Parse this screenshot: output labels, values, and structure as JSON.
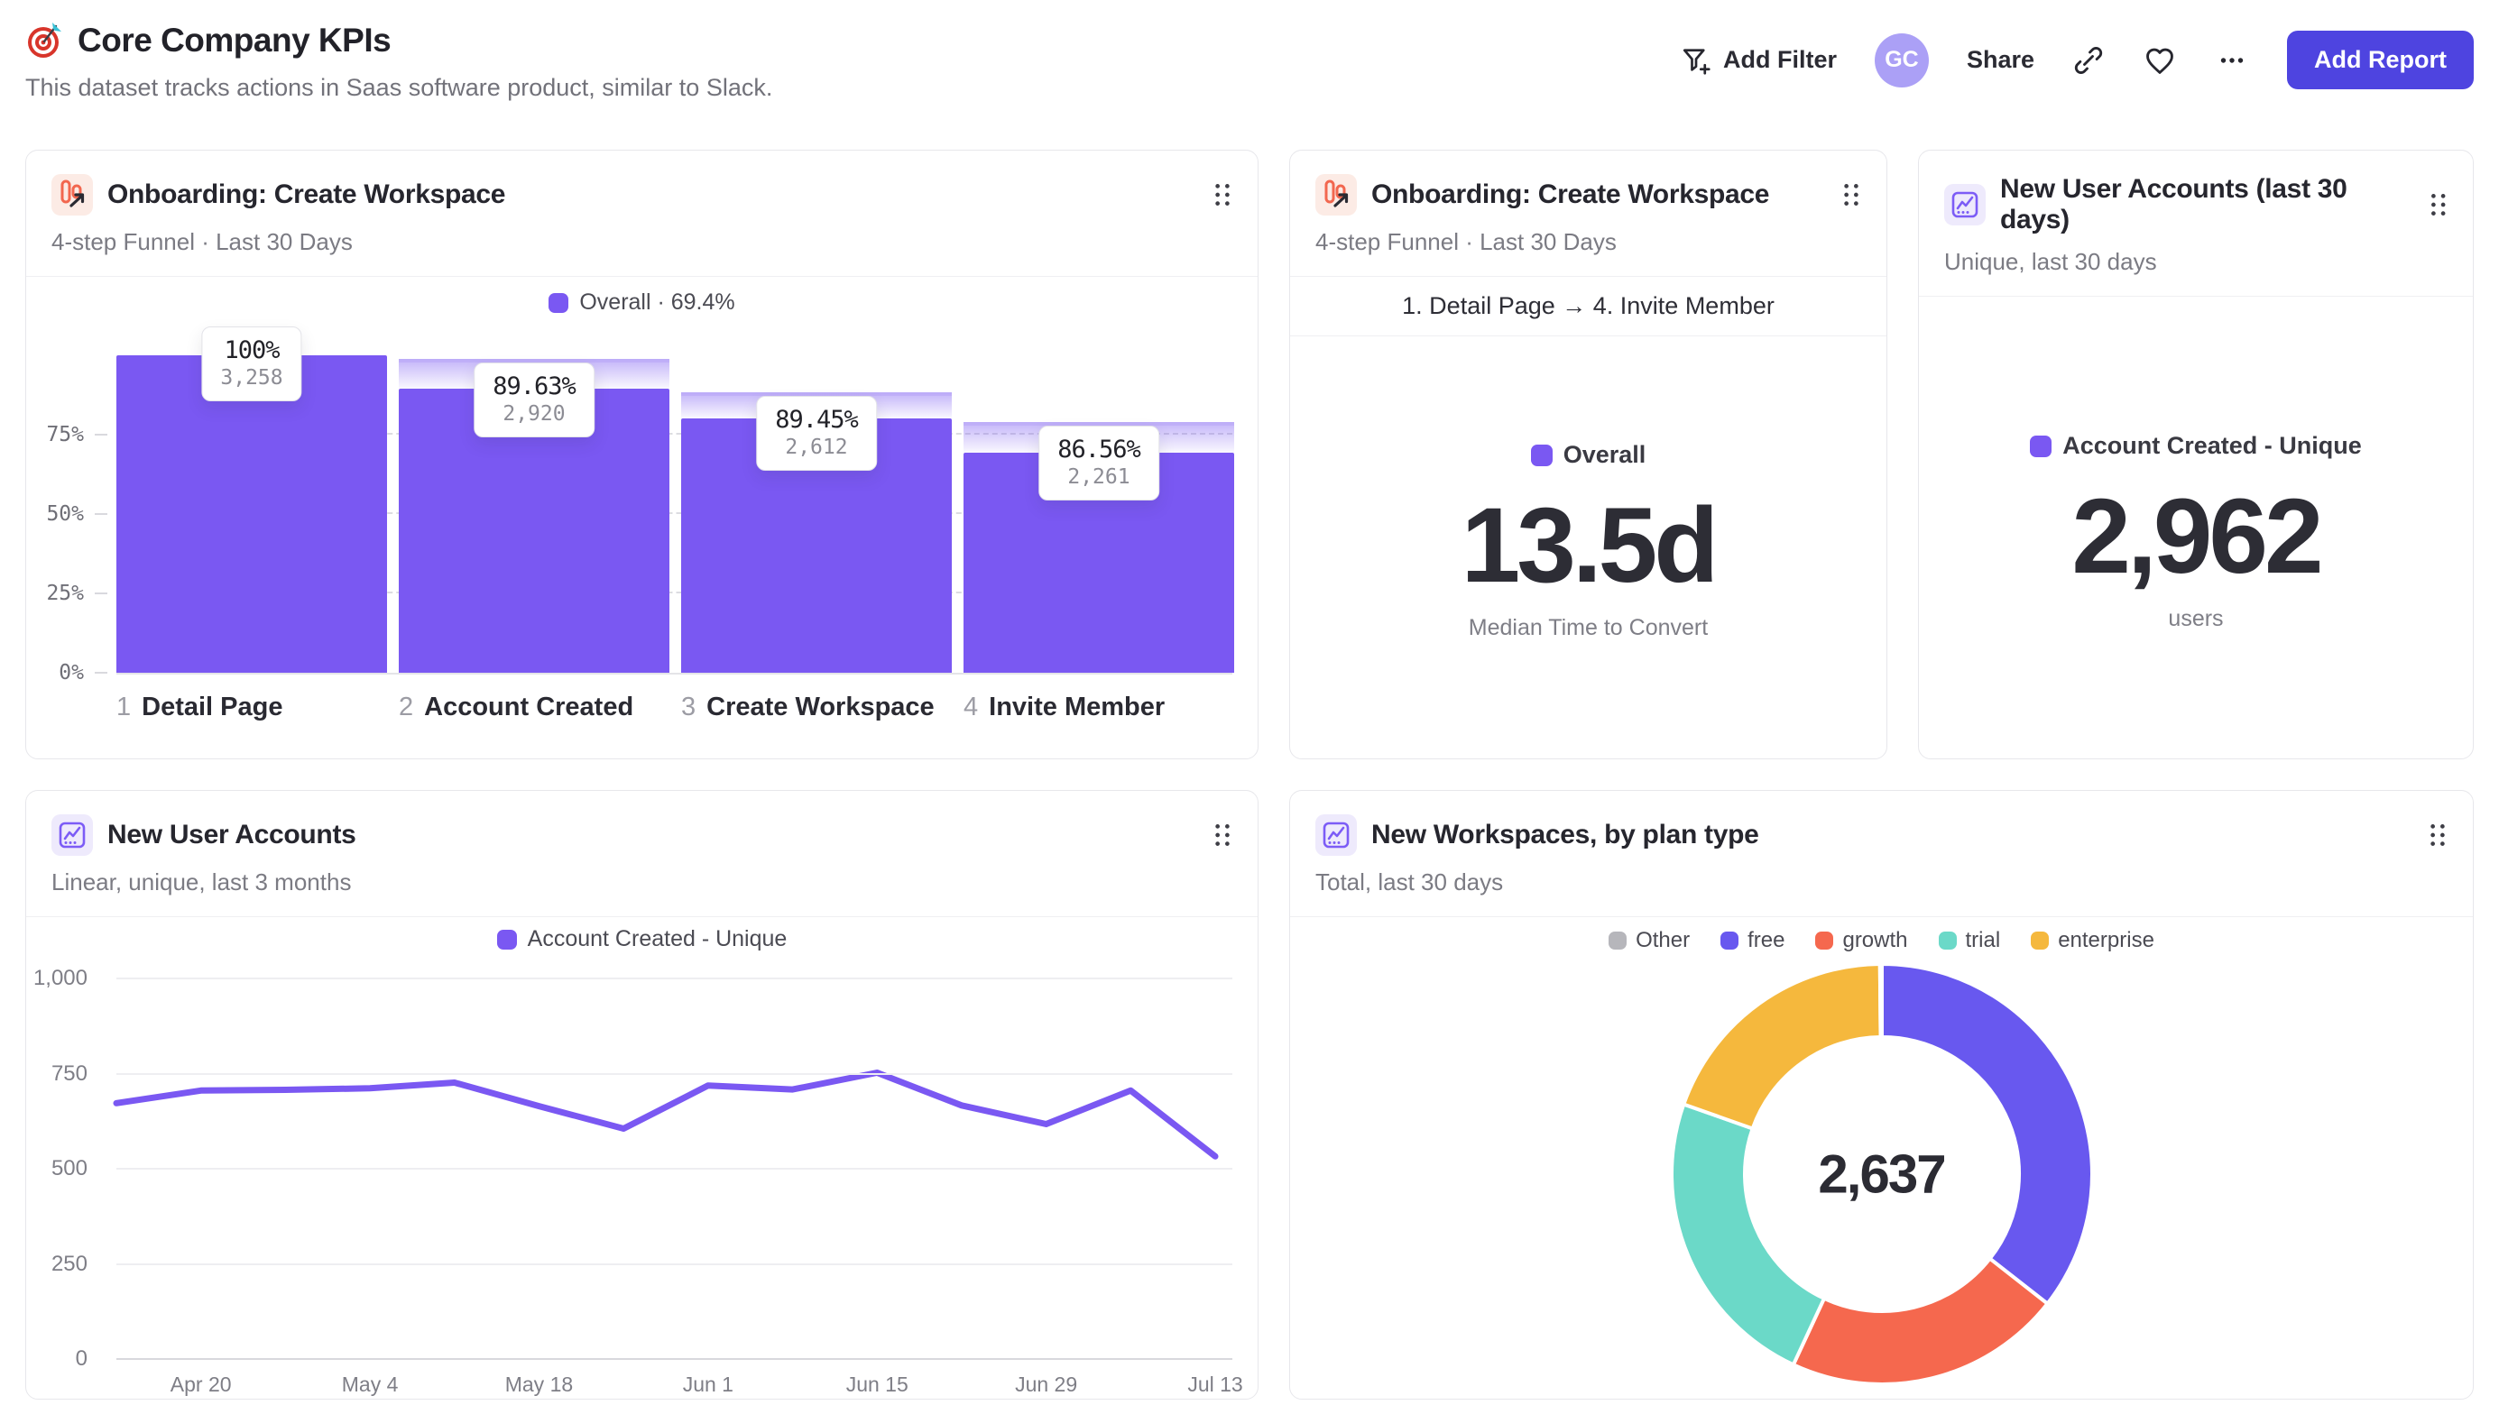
{
  "header": {
    "title": "Core Company KPIs",
    "subtitle": "This dataset tracks actions in Saas software product, similar to Slack.",
    "logo_icon": "target-dart-icon",
    "actions": {
      "add_filter": "Add Filter",
      "avatar_initials": "GC",
      "share": "Share",
      "add_report": "Add Report"
    }
  },
  "colors": {
    "accent_purple": "#7a58f2",
    "add_report_bg": "#4e44e0",
    "avatar_bg": "#aba0f6",
    "funnel_icon_red": "#f2674f",
    "donut_free": "#6858ef",
    "donut_growth": "#f5684e",
    "donut_trial": "#6bd9c8",
    "donut_enterprise": "#f5b83d",
    "donut_other": "#b6b6bb"
  },
  "cards": {
    "funnel_chart": {
      "title": "Onboarding: Create Workspace",
      "subtitle": "4-step Funnel · Last 30 Days",
      "legend_label": "Overall · 69.4%"
    },
    "funnel_metric": {
      "title": "Onboarding: Create Workspace",
      "subtitle": "4-step Funnel · Last 30 Days",
      "range_label": "1. Detail Page → 4. Invite Member",
      "legend_label": "Overall",
      "value": "13.5d",
      "caption": "Median Time to Convert"
    },
    "new_users_metric": {
      "title": "New User Accounts (last 30 days)",
      "subtitle": "Unique, last 30 days",
      "legend_label": "Account Created - Unique",
      "value": "2,962",
      "caption": "users"
    },
    "new_users_line": {
      "title": "New User Accounts",
      "subtitle": "Linear, unique, last 3 months",
      "legend_label": "Account Created - Unique"
    },
    "workspaces_donut": {
      "title": "New Workspaces, by plan type",
      "subtitle": "Total, last 30 days"
    }
  },
  "chart_data": [
    {
      "type": "bar",
      "subtype": "funnel",
      "title": "Onboarding: Create Workspace",
      "categories": [
        "Detail Page",
        "Account Created",
        "Create Workspace",
        "Invite Member"
      ],
      "step_numbers": [
        "1",
        "2",
        "3",
        "4"
      ],
      "values": [
        3258,
        2920,
        2612,
        2261
      ],
      "pct_labels": [
        "100%",
        "89.63%",
        "89.45%",
        "86.56%"
      ],
      "count_labels": [
        "3,258",
        "2,920",
        "2,612",
        "2,261"
      ],
      "overall_conversion": "69.4%",
      "y_tick_labels": [
        "0%",
        "25%",
        "50%",
        "75%"
      ],
      "y_tick_pcts": [
        0,
        25,
        50,
        75
      ],
      "ylim": [
        0,
        100
      ],
      "grid": "dashed-horizontal"
    },
    {
      "type": "metric",
      "title": "Onboarding: Create Workspace",
      "series": "Overall",
      "range": "1. Detail Page → 4. Invite Member",
      "value": "13.5d",
      "label": "Median Time to Convert"
    },
    {
      "type": "metric",
      "title": "New User Accounts (last 30 days)",
      "series": "Account Created - Unique",
      "value": "2,962",
      "label": "users"
    },
    {
      "type": "line",
      "series_name": "Account Created - Unique",
      "x": [
        "Apr 13",
        "Apr 20",
        "Apr 27",
        "May 4",
        "May 11",
        "May 18",
        "May 25",
        "Jun 1",
        "Jun 8",
        "Jun 15",
        "Jun 22",
        "Jun 29",
        "Jul 6",
        "Jul 13"
      ],
      "values": [
        670,
        703,
        705,
        709,
        724,
        662,
        603,
        716,
        706,
        750,
        664,
        615,
        703,
        530
      ],
      "x_tick_labels": [
        "Apr 20",
        "May 4",
        "May 18",
        "Jun 1",
        "Jun 15",
        "Jun 29",
        "Jul 13"
      ],
      "x_tick_indices": [
        1,
        3,
        5,
        7,
        9,
        11,
        13
      ],
      "y_ticks": [
        0,
        250,
        500,
        750,
        1000
      ],
      "y_tick_labels": [
        "0",
        "250",
        "500",
        "750",
        "1,000"
      ],
      "ylim": [
        0,
        1000
      ],
      "grid": "horizontal",
      "legend_position": "top"
    },
    {
      "type": "pie",
      "subtype": "donut",
      "labels": [
        "Other",
        "free",
        "growth",
        "trial",
        "enterprise"
      ],
      "values": [
        4,
        938,
        563,
        619,
        513
      ],
      "colors": [
        "#b6b6bb",
        "#6858ef",
        "#f5684e",
        "#6bd9c8",
        "#f5b83d"
      ],
      "draw_order": [
        1,
        2,
        3,
        4,
        0
      ],
      "total_label": "2,637",
      "legend_position": "top"
    }
  ]
}
